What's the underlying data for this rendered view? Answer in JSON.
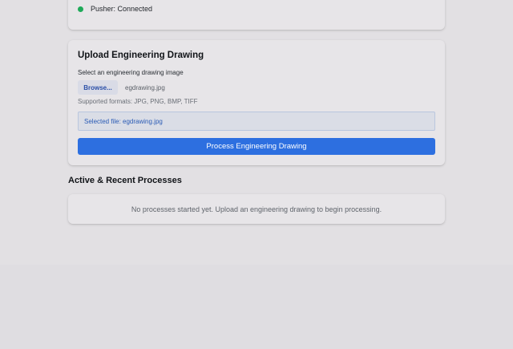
{
  "status": {
    "label": "Pusher: Connected",
    "dot_color": "#1faa59"
  },
  "upload": {
    "title": "Upload Engineering Drawing",
    "select_label": "Select an engineering drawing image",
    "browse_label": "Browse...",
    "file_name": "egdrawing.jpg",
    "supported_formats": "Supported formats: JPG, PNG, BMP, TIFF",
    "selected_file": "Selected file: egdrawing.jpg",
    "process_button": "Process Engineering Drawing",
    "accent_color": "#2d6fe0"
  },
  "processes": {
    "title": "Active & Recent Processes",
    "empty_message": "No processes started yet. Upload an engineering drawing to begin processing."
  }
}
